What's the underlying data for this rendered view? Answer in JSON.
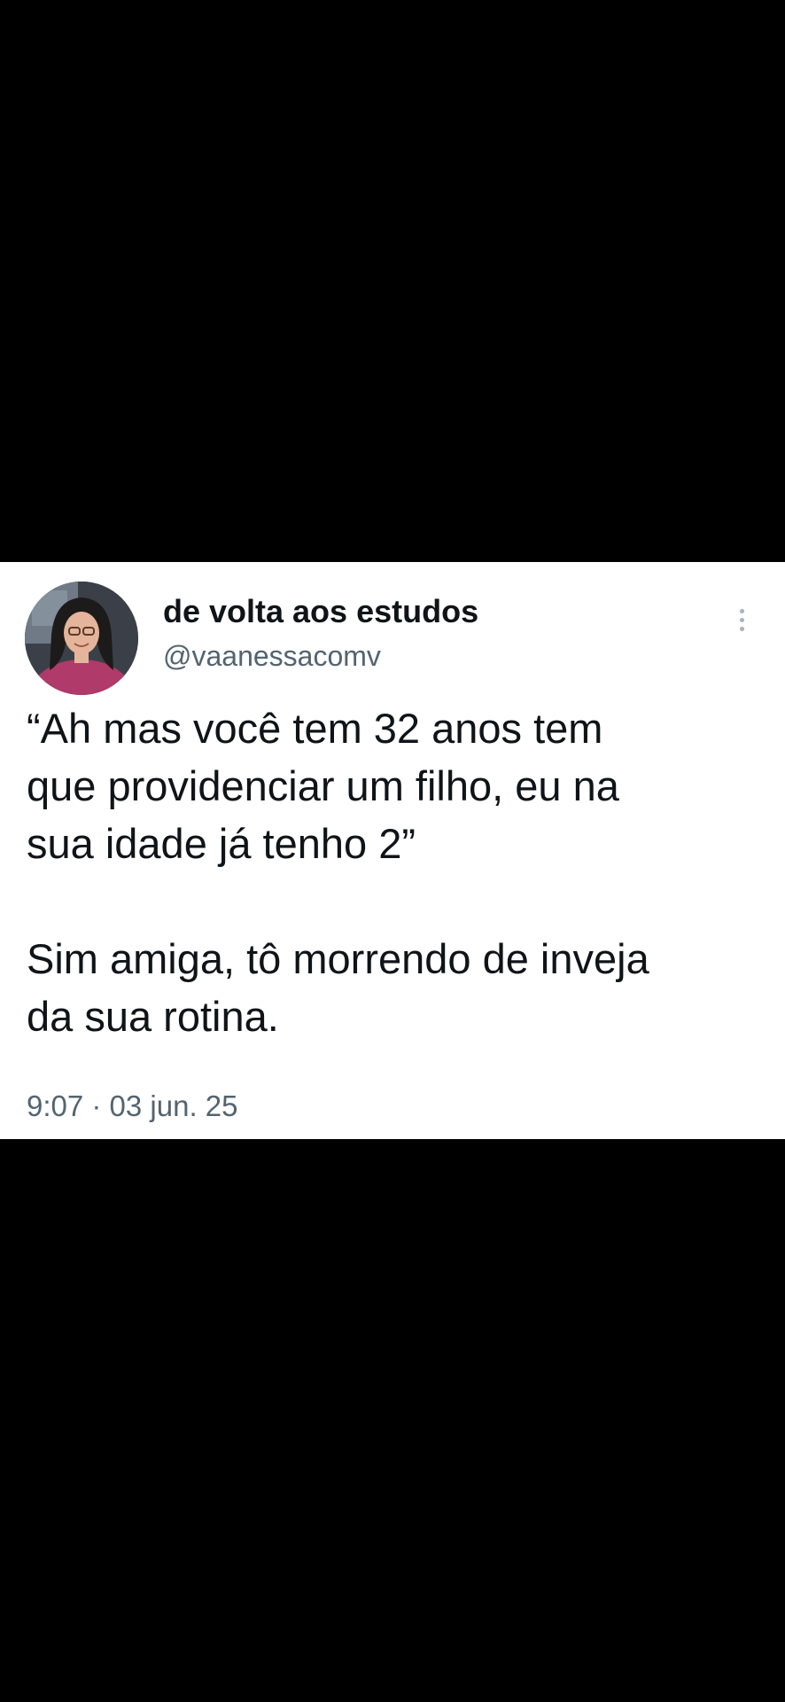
{
  "tweet": {
    "display_name": "de volta aos estudos",
    "handle": "@vaanessacomv",
    "paragraphs": [
      "“Ah mas você tem 32 anos tem\nque providenciar um filho, eu na\nsua idade já tenho 2”",
      "Sim amiga, tô morrendo de inveja\nda sua rotina."
    ],
    "timestamp": "9:07 · 03 jun. 25",
    "more_icon": "more-vertical-icon"
  },
  "colors": {
    "page_background": "#000000",
    "card_background": "#ffffff",
    "primary_text": "#0f1419",
    "secondary_text": "#536471"
  }
}
